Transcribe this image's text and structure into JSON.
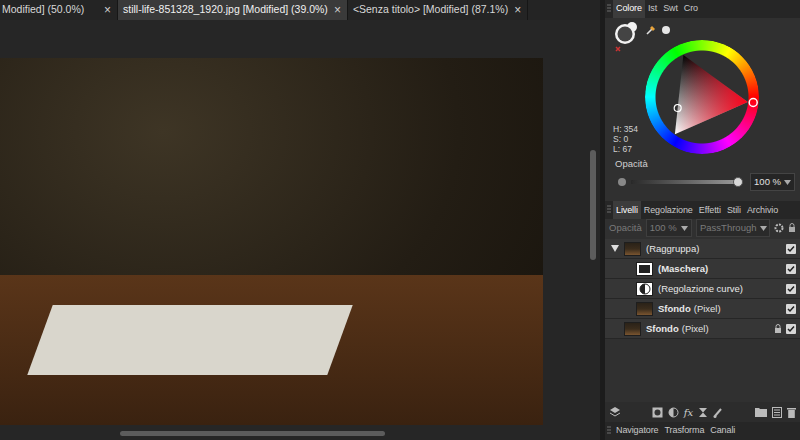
{
  "document_tabs": [
    {
      "label": "Modified] (50.0%)",
      "close": "×",
      "selected": false
    },
    {
      "label": "still-life-851328_1920.jpg [Modified] (39.0%)",
      "close": "×",
      "selected": true
    },
    {
      "label": "<Senza titolo> [Modified] (87.1%)",
      "close": "×",
      "selected": false
    }
  ],
  "color_panel": {
    "tabs": [
      {
        "label": "Colore",
        "selected": true
      },
      {
        "label": "Ist",
        "selected": false
      },
      {
        "label": "Swt",
        "selected": false
      },
      {
        "label": "Cro",
        "selected": false
      }
    ],
    "hue_level": 0.983,
    "saturation_level": 0,
    "lightness_level": 0.67,
    "readout": [
      "H: 354",
      "S: 0",
      "L: 67"
    ],
    "opacity": {
      "label": "Opacità",
      "level": 1,
      "reading": "100 %"
    }
  },
  "layers_panel": {
    "tabs": [
      {
        "label": "Livelli",
        "selected": true
      },
      {
        "label": "Regolazione",
        "selected": false
      },
      {
        "label": "Effetti",
        "selected": false
      },
      {
        "label": "Stili",
        "selected": false
      },
      {
        "label": "Archivio",
        "selected": false
      }
    ],
    "opacity_label": "Opacità",
    "opacity_value": "100 %",
    "blend_mode": "PassThrough",
    "controls_disabled": true,
    "layers": [
      {
        "name": "(Raggruppa)",
        "kind": "group",
        "in_group": false,
        "expanded": true,
        "bold": false,
        "visible": true,
        "locked": false
      },
      {
        "name": "(Maschera)",
        "kind": "mask",
        "in_group": true,
        "bold": true,
        "visible": true,
        "locked": false
      },
      {
        "name": "(Regolazione curve)",
        "kind": "adjustment",
        "in_group": true,
        "bold": false,
        "visible": true,
        "locked": false
      },
      {
        "name": "Sfondo",
        "type": "(Pixel)",
        "kind": "pixel",
        "in_group": true,
        "bold": true,
        "visible": true,
        "locked": false
      },
      {
        "name": "Sfondo",
        "type": "(Pixel)",
        "kind": "pixel",
        "in_group": false,
        "bold": true,
        "visible": true,
        "locked": true
      }
    ],
    "toolbar_fx": "fx"
  },
  "bottom_tabs": [
    {
      "label": "Navigatore",
      "selected": false
    },
    {
      "label": "Trasforma",
      "selected": false
    },
    {
      "label": "Canali",
      "selected": false
    }
  ]
}
